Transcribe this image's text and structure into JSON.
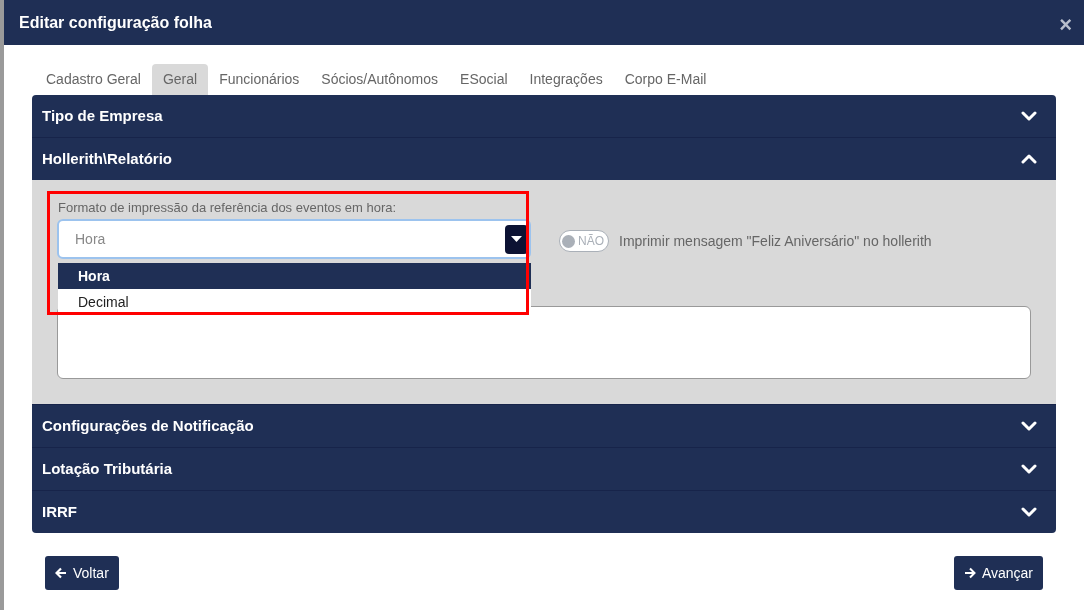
{
  "dialog": {
    "title": "Editar configuração folha",
    "close": "×"
  },
  "tabs": [
    {
      "label": "Cadastro Geral",
      "selected": false
    },
    {
      "label": "Geral",
      "selected": true
    },
    {
      "label": "Funcionários",
      "selected": false
    },
    {
      "label": "Sócios/Autônomos",
      "selected": false
    },
    {
      "label": "ESocial",
      "selected": false
    },
    {
      "label": "Integrações",
      "selected": false
    },
    {
      "label": "Corpo E-Mail",
      "selected": false
    }
  ],
  "sections": [
    {
      "title": "Tipo de Empresa",
      "expanded": false
    },
    {
      "title": "Hollerith\\Relatório",
      "expanded": true,
      "select": {
        "label": "Formato de impressão da referência dos eventos em hora:",
        "placeholder": "Hora",
        "open": true,
        "options": [
          {
            "label": "Hora",
            "selected": true
          },
          {
            "label": "Decimal",
            "selected": false
          }
        ]
      },
      "toggle": {
        "on": false,
        "text": "NÃO",
        "label": "Imprimir mensagem \"Feliz Aniversário\" no hollerith"
      }
    },
    {
      "title": "Configurações de Notificação",
      "expanded": false
    },
    {
      "title": "Lotação Tributária",
      "expanded": false
    },
    {
      "title": "IRRF",
      "expanded": false
    }
  ],
  "buttons": {
    "back": "Voltar",
    "next": "Avançar"
  }
}
